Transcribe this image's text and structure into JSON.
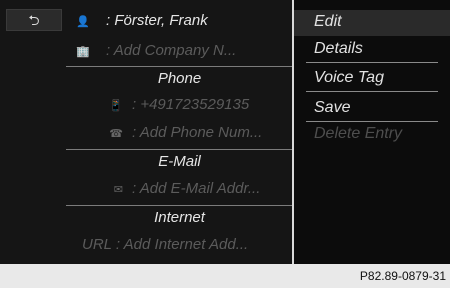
{
  "back_button": {
    "icon": "back-arrow-icon"
  },
  "entries": [
    {
      "icon": "person-icon",
      "text": ": Förster, Frank"
    },
    {
      "icon": "company-icon",
      "text": ": Add Company N..."
    },
    {
      "header": "Phone"
    },
    {
      "icon": "mobile-phone-icon",
      "text": ": +491723529135"
    },
    {
      "icon": "phone-handset-icon",
      "text": ": Add Phone Num..."
    },
    {
      "header": "E-Mail"
    },
    {
      "icon": "email-icon",
      "text": ": Add E-Mail Addr..."
    },
    {
      "header": "Internet"
    },
    {
      "icon": "url-icon",
      "text": "URL : Add Internet Add..."
    }
  ],
  "menu": {
    "items": [
      {
        "label": "Edit",
        "selected": true
      },
      {
        "label": "Details"
      },
      {
        "label": "Voice Tag"
      },
      {
        "label": "Save"
      },
      {
        "label": "Delete Entry",
        "disabled": true
      }
    ]
  },
  "caption": "P82.89-0879-31"
}
